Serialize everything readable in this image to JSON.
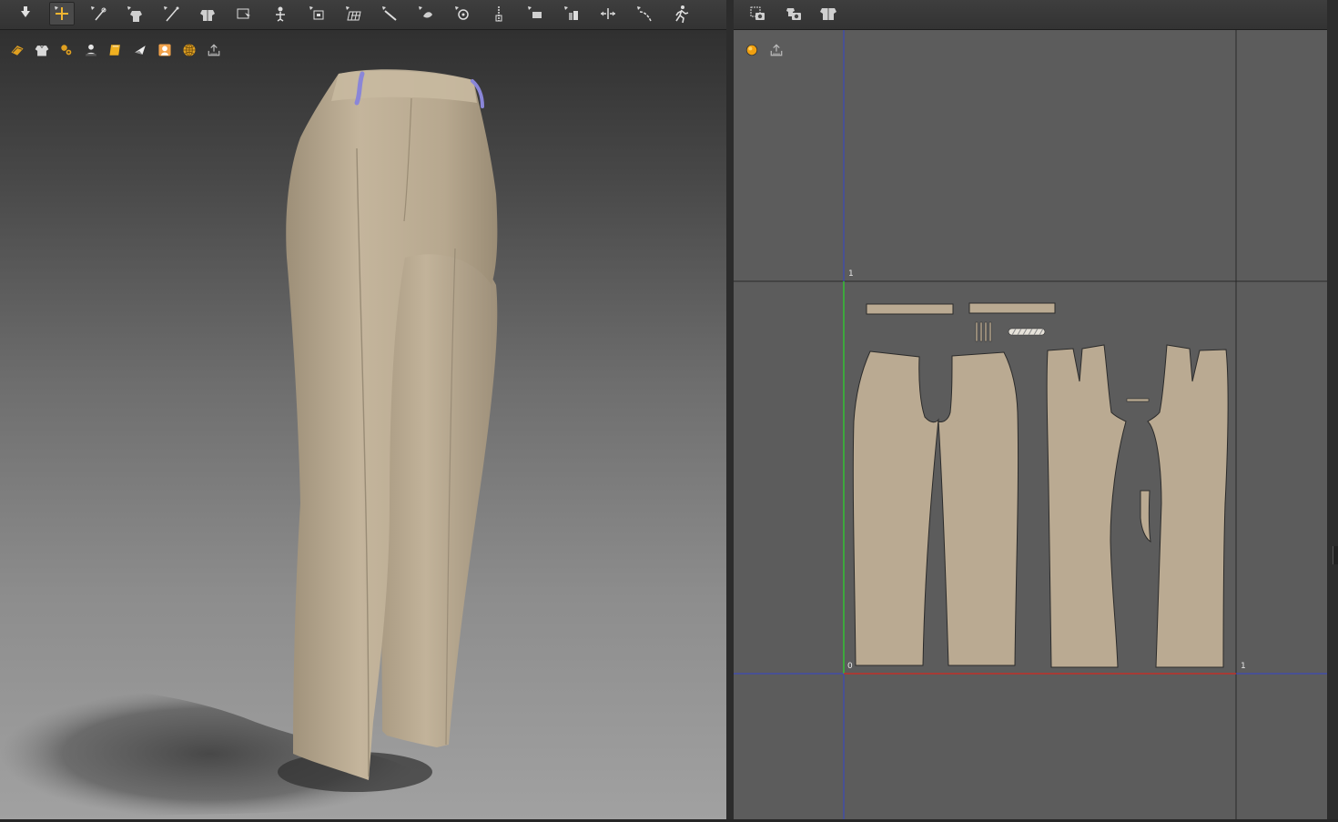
{
  "toolbar_3d": {
    "tools": [
      {
        "icon": "dropdown-arrow-icon",
        "active": false
      },
      {
        "icon": "select-move-icon",
        "active": true
      },
      {
        "icon": "select-mesh-icon",
        "active": false
      },
      {
        "icon": "transform-pattern-icon",
        "active": false
      },
      {
        "icon": "edit-pattern-icon",
        "active": false
      },
      {
        "icon": "fold-arrangement-icon",
        "active": false
      },
      {
        "icon": "tack-icon",
        "active": false
      },
      {
        "icon": "arrangement-point-icon",
        "active": false
      },
      {
        "icon": "pin-icon",
        "active": false
      },
      {
        "icon": "texture-grid-icon",
        "active": false
      },
      {
        "icon": "steam-icon",
        "active": false
      },
      {
        "icon": "trim-icon",
        "active": false
      },
      {
        "icon": "button-icon",
        "active": false
      },
      {
        "icon": "zipper-icon",
        "active": false
      },
      {
        "icon": "tape-icon",
        "active": false
      },
      {
        "icon": "puckering-icon",
        "active": false
      },
      {
        "icon": "measure-icon",
        "active": false
      },
      {
        "icon": "line-seam-icon",
        "active": false
      },
      {
        "icon": "walk-avatar-icon",
        "active": false
      }
    ]
  },
  "toolbar_2d": {
    "tools": [
      {
        "icon": "snapshot-2d-icon"
      },
      {
        "icon": "snapshot-3d-icon"
      },
      {
        "icon": "arrangement-snapshot-icon"
      }
    ]
  },
  "view3d": {
    "display_icons": [
      "garment-display-icon",
      "shirt-display-icon",
      "texture-display-icon",
      "avatar-display-icon",
      "surface-display-icon",
      "light-display-icon",
      "skin-display-icon",
      "globe-display-icon",
      "export-display-icon"
    ]
  },
  "view2d": {
    "display_icons": [
      "sphere-display-icon",
      "export-display-icon"
    ],
    "axis_labels": {
      "top_one": "1",
      "origin": "0",
      "right_one": "1"
    }
  },
  "colors": {
    "fabric": "#baaa92",
    "fabric_edge": "#2b2b2b",
    "grid_bg": "#5c5c5c",
    "x_axis": "#c0302a",
    "y_axis": "#33c233",
    "blue_line": "#3344cc"
  }
}
